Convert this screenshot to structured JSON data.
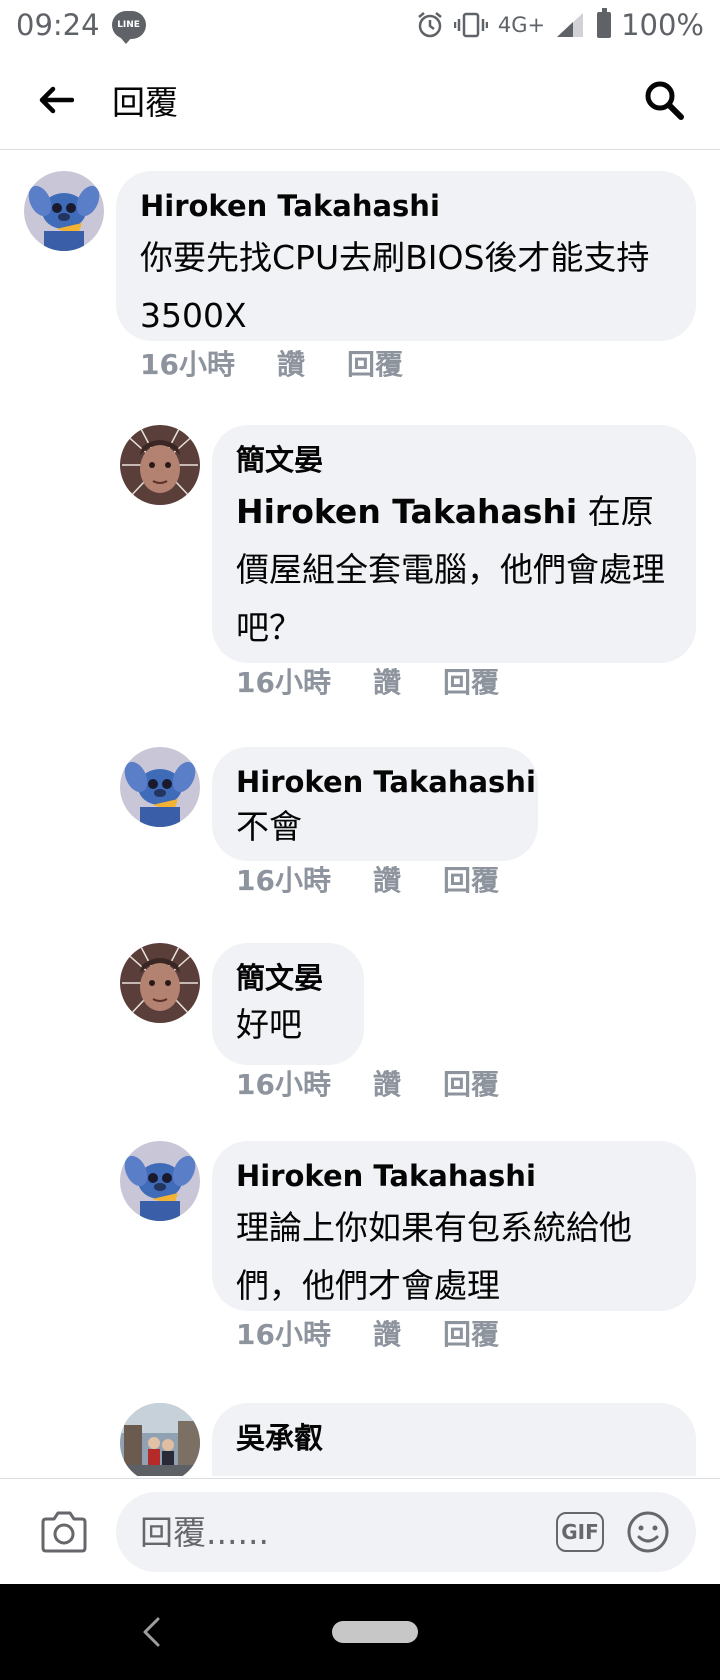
{
  "status_bar": {
    "time": "09:24",
    "line_badge": "LINE",
    "network": "4G+",
    "battery": "100%"
  },
  "header": {
    "title": "回覆"
  },
  "comments": [
    {
      "author": "Hiroken Takahashi",
      "text": "你要先找CPU去刷BIOS後才能支持3500X",
      "time": "16小時",
      "like": "讚",
      "reply": "回覆"
    },
    {
      "author": "簡文晏",
      "mention": "Hiroken Takahashi",
      "text": " 在原價屋組全套電腦，他們會處理吧？",
      "time": "16小時",
      "like": "讚",
      "reply": "回覆"
    },
    {
      "author": "Hiroken Takahashi",
      "text": "不會",
      "time": "16小時",
      "like": "讚",
      "reply": "回覆"
    },
    {
      "author": "簡文晏",
      "text": "好吧",
      "time": "16小時",
      "like": "讚",
      "reply": "回覆"
    },
    {
      "author": "Hiroken Takahashi",
      "text": "理論上你如果有包系統給他們，他們才會處理",
      "time": "16小時",
      "like": "讚",
      "reply": "回覆"
    },
    {
      "author": "吳承叡",
      "text": ""
    }
  ],
  "composer": {
    "placeholder": "回覆......",
    "gif_label": "GIF"
  },
  "colors": {
    "bubble": "#f0f2f5",
    "meta": "#8d949e",
    "text": "#050505"
  }
}
